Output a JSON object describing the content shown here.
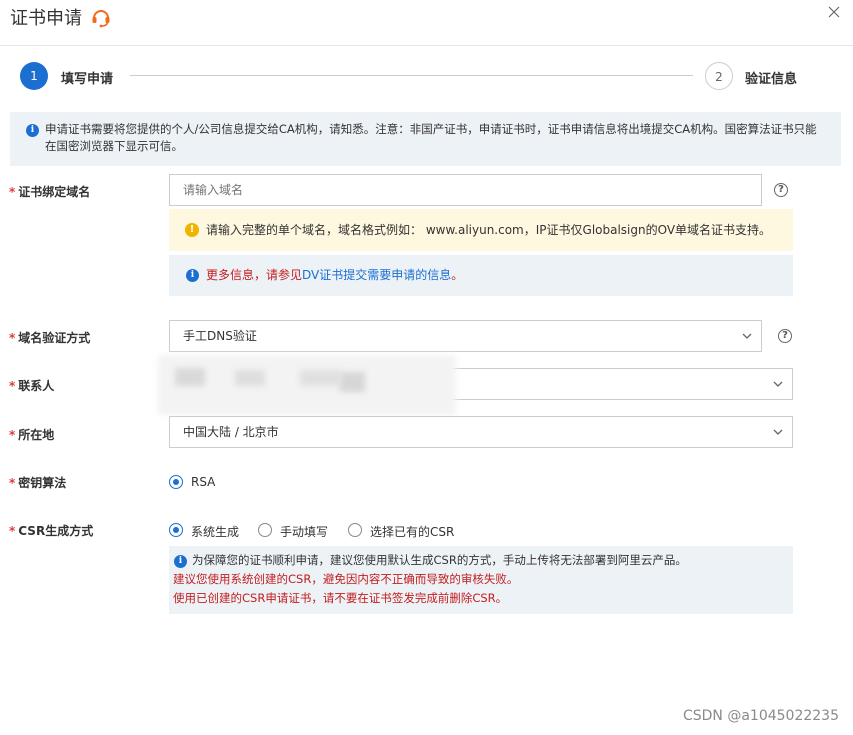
{
  "header": {
    "title": "证书申请"
  },
  "steps": [
    {
      "number": "1",
      "label": "填写申请"
    },
    {
      "number": "2",
      "label": "验证信息"
    }
  ],
  "banner": {
    "text": "申请证书需要将您提供的个人/公司信息提交给CA机构，请知悉。注意：非国产证书，申请证书时，证书申请信息将出境提交CA机构。国密算法证书只能在国密浏览器下显示可信。"
  },
  "form": {
    "domain": {
      "label": "证书绑定域名",
      "placeholder": "请输入域名",
      "warning": "请输入完整的单个域名，域名格式例如： www.aliyun.com，IP证书仅Globalsign的OV单域名证书支持。",
      "more_prefix": "更多信息，请参见",
      "more_link": "DV证书提交需要申请的信息",
      "more_suffix": "。"
    },
    "verify_method": {
      "label": "域名验证方式",
      "value": "手工DNS验证"
    },
    "contact": {
      "label": "联系人"
    },
    "location": {
      "label": "所在地",
      "value": "中国大陆 / 北京市"
    },
    "key_algorithm": {
      "label": "密钥算法",
      "options": [
        {
          "label": "RSA",
          "checked": true
        }
      ]
    },
    "csr": {
      "label": "CSR生成方式",
      "options": [
        {
          "label": "系统生成",
          "checked": true
        },
        {
          "label": "手动填写",
          "checked": false
        },
        {
          "label": "选择已有的CSR",
          "checked": false
        }
      ],
      "tip": "为保障您的证书顺利申请，建议您使用默认生成CSR的方式，手动上传将无法部署到阿里云产品。",
      "warn1": "建议您使用系统创建的CSR，避免因内容不正确而导致的审核失败。",
      "warn2": "使用已创建的CSR申请证书，请不要在证书签发完成前删除CSR。"
    }
  },
  "watermark": "CSDN @a1045022235",
  "colors": {
    "primary": "#1a6fd1",
    "warning": "#f0b400",
    "error": "#c21d1d",
    "info_bg": "#edf2f7",
    "warn_bg": "#fff8e0"
  }
}
